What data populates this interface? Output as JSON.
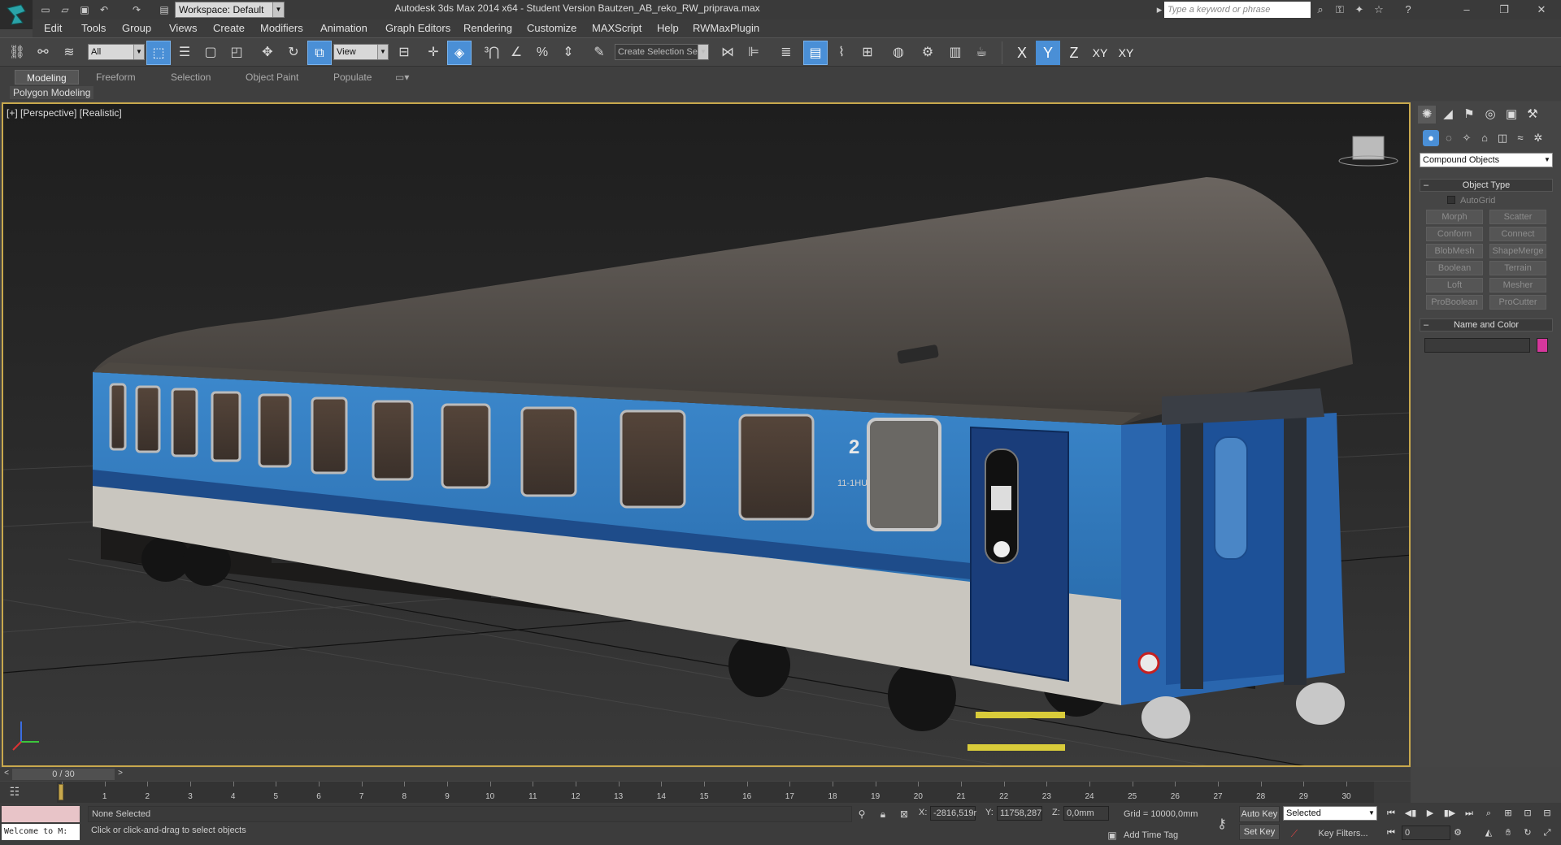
{
  "title_bar": {
    "workspace": "Workspace: Default",
    "title": "Autodesk 3ds Max  2014 x64  - Student Version   Bautzen_AB_reko_RW_priprava.max",
    "search_placeholder": "Type a keyword or phrase"
  },
  "menu": [
    "Edit",
    "Tools",
    "Group",
    "Views",
    "Create",
    "Modifiers",
    "Animation",
    "Graph Editors",
    "Rendering",
    "Customize",
    "MAXScript",
    "Help",
    "RWMaxPlugin"
  ],
  "toolbar": {
    "filter": "All",
    "ref_coord": "View",
    "selection_set": "Create Selection Se",
    "axes": [
      "X",
      "Y",
      "Z",
      "XY",
      "XY"
    ]
  },
  "ribbon": {
    "tabs": [
      "Modeling",
      "Freeform",
      "Selection",
      "Object Paint",
      "Populate"
    ],
    "active_tab": "Modeling",
    "panel": "Polygon Modeling"
  },
  "viewport": {
    "label": "[+] [Perspective] [Realistic]",
    "car_class": "2",
    "car_class_sub": "11-1HU"
  },
  "command_panel": {
    "category": "Compound Objects",
    "object_type_title": "Object Type",
    "autogrid": "AutoGrid",
    "buttons": [
      "Morph",
      "Scatter",
      "Conform",
      "Connect",
      "BlobMesh",
      "ShapeMerge",
      "Boolean",
      "Terrain",
      "Loft",
      "Mesher",
      "ProBoolean",
      "ProCutter"
    ],
    "name_color_title": "Name and Color",
    "swatch_color": "#d6379c"
  },
  "time_slider": {
    "frame": "0 / 30"
  },
  "trackbar": {
    "ticks": [
      "0",
      "1",
      "2",
      "3",
      "4",
      "5",
      "6",
      "7",
      "8",
      "9",
      "10",
      "11",
      "12",
      "13",
      "14",
      "15",
      "16",
      "17",
      "18",
      "19",
      "20",
      "21",
      "22",
      "23",
      "24",
      "25",
      "26",
      "27",
      "28",
      "29",
      "30"
    ]
  },
  "status": {
    "maxscript": "Welcome to M:",
    "selection": "None Selected",
    "prompt": "Click or click-and-drag to select objects",
    "x_label": "X:",
    "x_value": "-2816,519r",
    "y_label": "Y:",
    "y_value": "11758,287",
    "z_label": "Z:",
    "z_value": "0,0mm",
    "grid": "Grid = 10000,0mm",
    "add_time_tag": "Add Time Tag",
    "auto_key": "Auto Key",
    "set_key": "Set Key",
    "key_mode": "Selected",
    "key_filters": "Key Filters...",
    "current_frame": "0"
  }
}
